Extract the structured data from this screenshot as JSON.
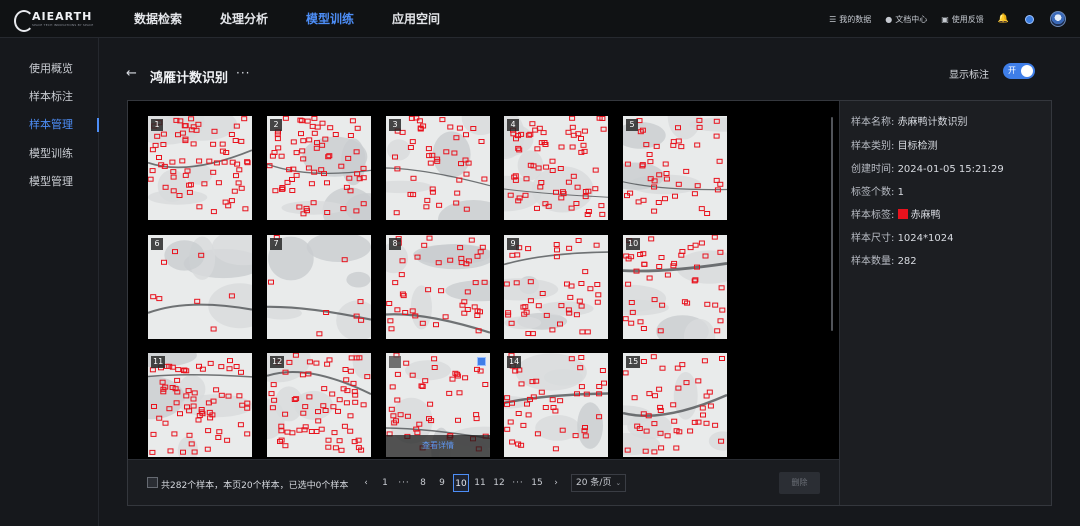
{
  "brand": {
    "name": "AIEARTH",
    "tagline": "SPACE TECH INNOVATIONS BY SPACE"
  },
  "nav": [
    "数据检索",
    "处理分析",
    "模型训练",
    "应用空间"
  ],
  "nav_active": "模型训练",
  "tools": {
    "my_data": "我的数据",
    "docs": "文档中心",
    "feedback": "使用反馈"
  },
  "sidebar": [
    "使用概览",
    "样本标注",
    "样本管理",
    "模型训练",
    "模型管理"
  ],
  "sidebar_active": "样本管理",
  "page": {
    "back": "←",
    "title": "鸿雁计数识别",
    "more": "···"
  },
  "toggle": {
    "label": "显示标注",
    "state": "开"
  },
  "thumbnails": [
    {
      "num": "1"
    },
    {
      "num": "2"
    },
    {
      "num": "3"
    },
    {
      "num": "4"
    },
    {
      "num": "5"
    },
    {
      "num": "6"
    },
    {
      "num": "7"
    },
    {
      "num": "8"
    },
    {
      "num": "9"
    },
    {
      "num": "10"
    },
    {
      "num": "11"
    },
    {
      "num": "12"
    },
    {
      "num": ""
    },
    {
      "num": "14"
    },
    {
      "num": "15"
    }
  ],
  "hover_overlay": "查看详情",
  "footer": {
    "info": "共282个样本，本页20个样本，已选中0个样本",
    "pages": [
      "‹",
      "1",
      "···",
      "8",
      "9",
      "10",
      "11",
      "12",
      "···",
      "15",
      "›"
    ],
    "active_page": "10",
    "per_page": "20 条/页",
    "delete": "删除"
  },
  "info": {
    "name_label": "样本名称:",
    "name": "赤麻鸭计数识别",
    "type_label": "样本类别:",
    "type": "目标检测",
    "created_label": "创建时间:",
    "created": "2024-01-05 15:21:29",
    "tag_count_label": "标签个数:",
    "tag_count": "1",
    "tag_label": "样本标签:",
    "tag": "赤麻鸭",
    "tag_color": "#e8121d",
    "size_label": "样本尺寸:",
    "size": "1024*1024",
    "count_label": "样本数量:",
    "count": "282"
  },
  "colors": {
    "accent": "#4d8ef7",
    "annotation": "#e8121d"
  }
}
